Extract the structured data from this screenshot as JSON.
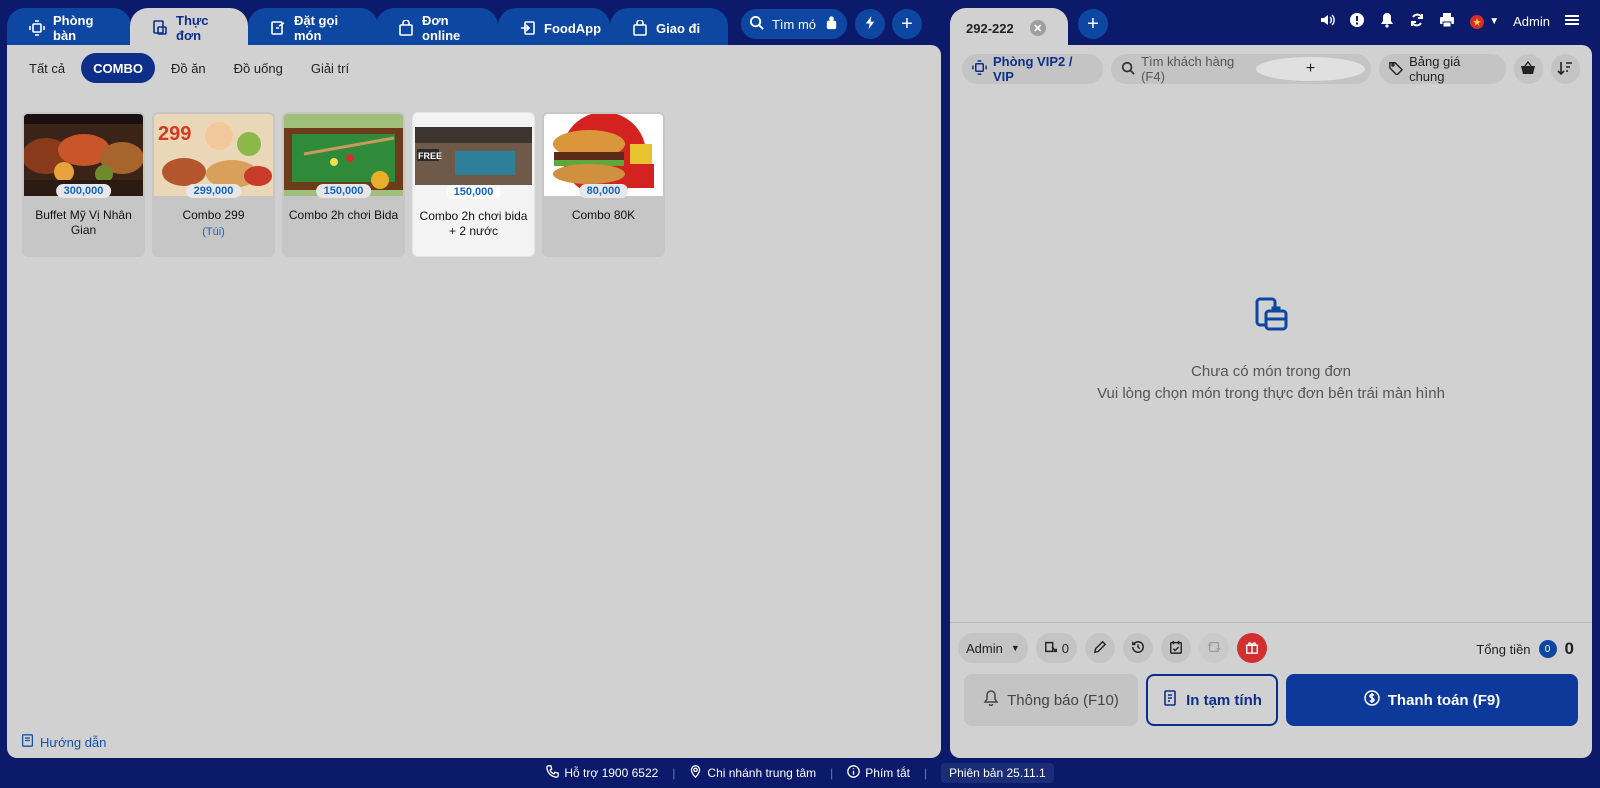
{
  "tabs": [
    {
      "label": "Phòng bàn",
      "icon": "table-icon",
      "active": false
    },
    {
      "label": "Thực đơn",
      "icon": "menu-icon",
      "active": true
    },
    {
      "label": "Đặt gọi món",
      "icon": "order-icon",
      "active": false
    },
    {
      "label": "Đơn online",
      "icon": "bag-icon",
      "active": false
    },
    {
      "label": "FoodApp",
      "icon": "login-icon",
      "active": false
    },
    {
      "label": "Giao đi",
      "icon": "bag-icon",
      "active": false
    }
  ],
  "search_dish": {
    "label": "Tìm mó"
  },
  "categories": [
    {
      "label": "Tất cả"
    },
    {
      "label": "COMBO",
      "active": true
    },
    {
      "label": "Đồ ăn"
    },
    {
      "label": "Đồ uống"
    },
    {
      "label": "Giải trí"
    }
  ],
  "products": [
    {
      "name": "Buffet Mỹ Vị Nhân Gian",
      "price": "300,000",
      "unit": ""
    },
    {
      "name": "Combo 299",
      "price": "299,000",
      "unit": "(Túi)"
    },
    {
      "name": "Combo 2h chơi Bida",
      "price": "150,000",
      "unit": ""
    },
    {
      "name": "Combo 2h chơi bida + 2 nước",
      "price": "150,000",
      "unit": "",
      "selected": true
    },
    {
      "name": "Combo 80K",
      "price": "80,000",
      "unit": ""
    }
  ],
  "guide": {
    "label": "Hướng dẫn"
  },
  "order": {
    "tab_label": "292-222",
    "room": "Phòng VIP2 / VIP",
    "customer_search_placeholder": "Tìm khách hàng (F4)",
    "price_list": "Bảng giá chung",
    "user": "Admin",
    "empty_line1": "Chưa có món trong đơn",
    "empty_line2": "Vui lòng chọn món trong thực đơn bên trái màn hình",
    "staff": "Admin",
    "guest_count": "0",
    "total_label": "Tổng tiền",
    "total_count": "0",
    "total_value": "0",
    "notify_label": "Thông báo (F10)",
    "print_label": "In tạm tính",
    "pay_label": "Thanh toán (F9)"
  },
  "footer": {
    "support": "Hỗ trợ 1900 6522",
    "branch": "Chi nhánh trung tâm",
    "shortcuts": "Phím tắt",
    "version": "Phiên bản 25.11.1"
  },
  "colors": {
    "primary": "#0d47a1",
    "dark": "#0b1a6b",
    "panel": "#d1d1d1",
    "price": "#1565c0",
    "gift": "#d32f2f"
  }
}
